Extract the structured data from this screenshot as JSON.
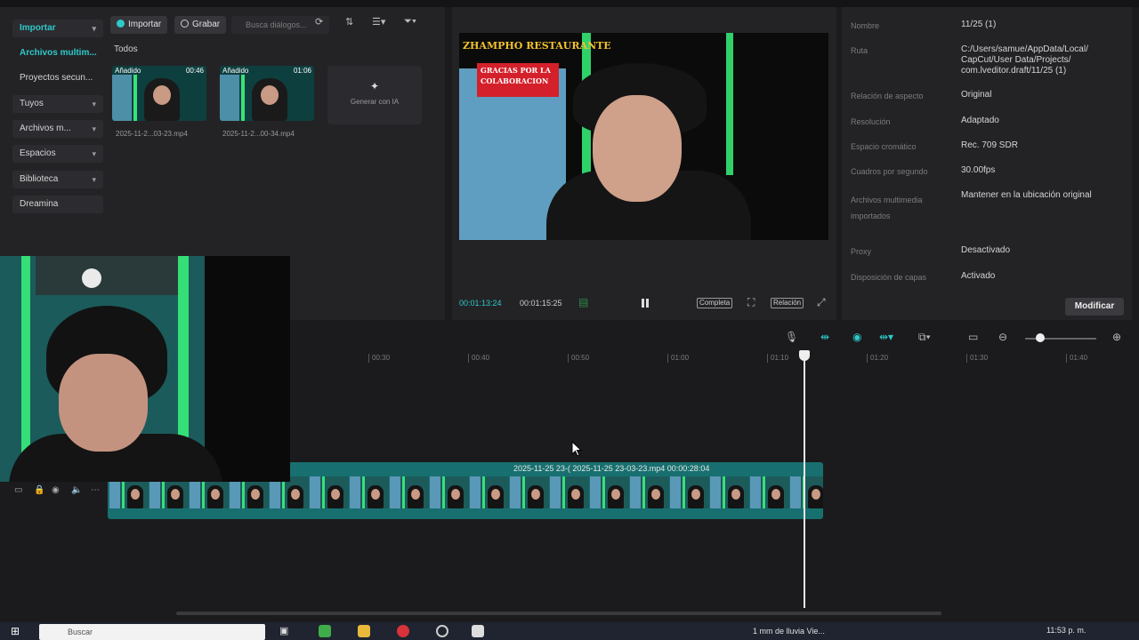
{
  "media_panel": {
    "nav": [
      {
        "label": "Importar",
        "active": true,
        "chevron": true
      },
      {
        "label": "Archivos multim...",
        "active": true,
        "chevron": false,
        "plain": true
      },
      {
        "label": "Proyectos secun...",
        "chevron": false,
        "plain": true
      },
      {
        "label": "Tuyos",
        "chevron": true
      },
      {
        "label": "Archivos m...",
        "chevron": true
      },
      {
        "label": "Espacios",
        "chevron": true
      },
      {
        "label": "Biblioteca",
        "chevron": true
      },
      {
        "label": "Dreamina",
        "chevron": false
      }
    ],
    "toolbar": {
      "import_label": "Importar",
      "record_label": "Grabar",
      "search_placeholder": "Busca diálogos..."
    },
    "section_title": "Todos",
    "clips": [
      {
        "tag": "Añadido",
        "duration": "00:46",
        "filename": "2025-11-2...03-23.mp4"
      },
      {
        "tag": "Añadido",
        "duration": "01:06",
        "filename": "2025-11-2...00-34.mp4"
      }
    ],
    "ai_card_label": "Generar con IA"
  },
  "player": {
    "sticker_title": "ZHAMPHO RESTAURANTE",
    "sticker_text": "GRACIAS POR LA COLABORACION",
    "current_time": "00:01:13:24",
    "total_time": "00:01:15:25",
    "btn_full": "Completa",
    "btn_ratio": "Relación"
  },
  "details": {
    "rows": [
      {
        "label": "Nombre",
        "value": "11/25 (1)"
      },
      {
        "label": "Ruta",
        "value": "C:/Users/samue/AppData/Local/ CapCut/User Data/Projects/ com.lveditor.draft/11/25 (1)"
      },
      {
        "label": "Relación de aspecto",
        "value": "Original"
      },
      {
        "label": "Resolución",
        "value": "Adaptado"
      },
      {
        "label": "Espacio cromático",
        "value": "Rec. 709 SDR"
      },
      {
        "label": "Cuadros por segundo",
        "value": "30.00fps"
      },
      {
        "label": "Archivos multimedia importados",
        "value": "Mantener en la ubicación original"
      },
      {
        "label": "Proxy",
        "value": "Desactivado"
      },
      {
        "label": "Disposición de capas",
        "value": "Activado"
      }
    ],
    "modify_label": "Modificar"
  },
  "timeline": {
    "ticks": [
      "00:30",
      "00:40",
      "00:50",
      "01:00",
      "01:10",
      "01:20",
      "01:30",
      "01:40"
    ],
    "clip_label": "2025-11-25 23-( 2025-11-25 23-03-23.mp4   00:00:28:04"
  },
  "taskbar": {
    "search_placeholder": "Buscar",
    "weather": "1 mm de lluvia Vie...",
    "clock": "11:53 p. m."
  },
  "colors": {
    "accent": "#2fc9c9",
    "clip": "#17706f",
    "panel": "#232326"
  }
}
